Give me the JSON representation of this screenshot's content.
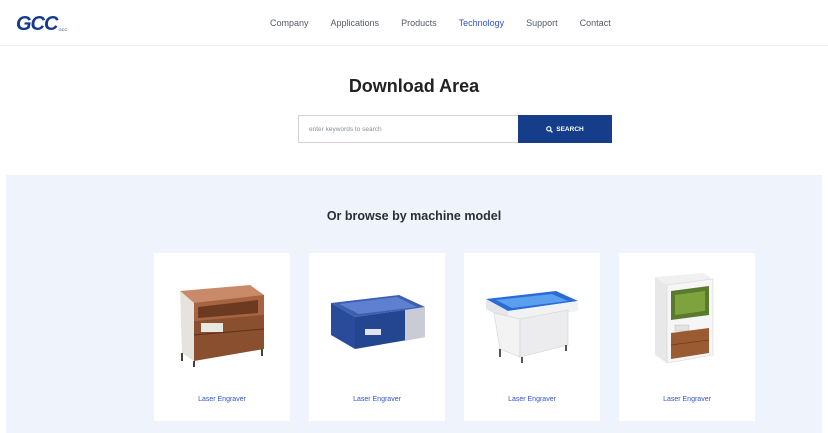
{
  "brand": {
    "logo": "GCC",
    "logo_sub": "GCC"
  },
  "nav": {
    "items": [
      {
        "label": "Company"
      },
      {
        "label": "Applications"
      },
      {
        "label": "Products"
      },
      {
        "label": "Technology"
      },
      {
        "label": "Support"
      },
      {
        "label": "Contact"
      }
    ],
    "active": "Technology"
  },
  "download": {
    "title": "Download Area",
    "search_placeholder": "enter keywords to search",
    "search_button": "SEARCH"
  },
  "browse": {
    "title": "Or browse by machine model",
    "cards": [
      {
        "label": "Laser Engraver",
        "icon": "brown-laser-engraver-image"
      },
      {
        "label": "Laser Engraver",
        "icon": "blue-laser-engraver-image"
      },
      {
        "label": "Laser Engraver",
        "icon": "white-blue-laser-engraver-image"
      },
      {
        "label": "Laser Engraver",
        "icon": "enclosed-laser-engraver-image"
      }
    ]
  },
  "colors": {
    "brand_blue": "#153d8a",
    "link_blue": "#2f55c9",
    "section_bg": "#eef3fc"
  }
}
